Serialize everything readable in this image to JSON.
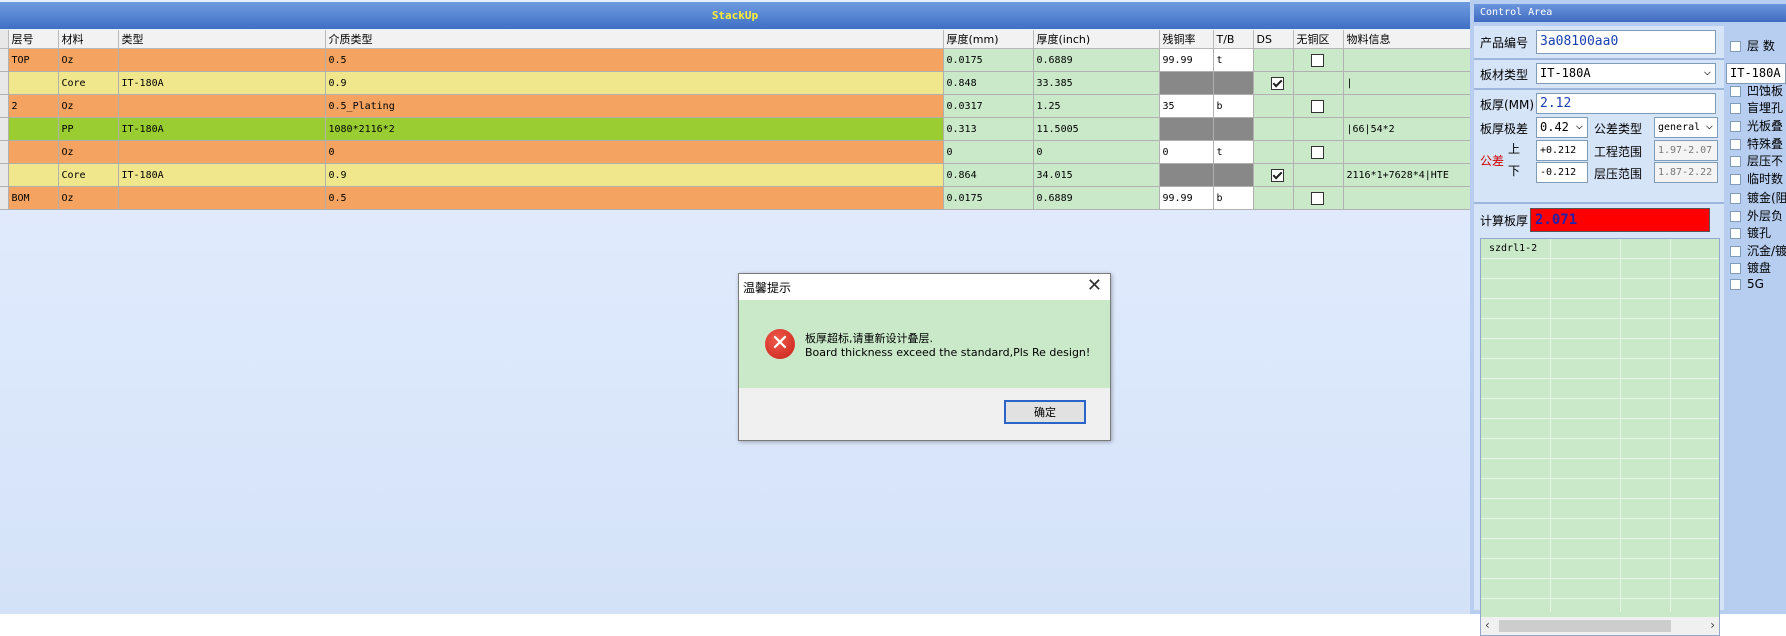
{
  "stackup": {
    "title": "StackUp",
    "columns": [
      "层号",
      "材料",
      "类型",
      "介质类型",
      "厚度(mm)",
      "厚度(inch)",
      "残铜率",
      "T/B",
      "DS",
      "无铜区",
      "物料信息"
    ],
    "rows": [
      {
        "layer": "TOP",
        "material": "Oz",
        "type": "",
        "dielectric": "0.5",
        "mm": "0.0175",
        "inch": "0.6889",
        "copper": "99.99",
        "tb": "t",
        "ds": "",
        "nocopper": "unchecked",
        "info": "",
        "color": "orange"
      },
      {
        "layer": "",
        "material": "Core",
        "type": "IT-180A",
        "dielectric": "0.9",
        "mm": "0.848",
        "inch": "33.385",
        "copper": "",
        "tb": "",
        "ds": "checked",
        "nocopper": "",
        "info": "|",
        "color": "yellow"
      },
      {
        "layer": "2",
        "material": "Oz",
        "type": "",
        "dielectric": "0.5_Plating",
        "mm": "0.0317",
        "inch": "1.25",
        "copper": "35",
        "tb": "b",
        "ds": "",
        "nocopper": "unchecked",
        "info": "",
        "color": "orange"
      },
      {
        "layer": "",
        "material": "PP",
        "type": "IT-180A",
        "dielectric": "1080*2116*2",
        "mm": "0.313",
        "inch": "11.5005",
        "copper": "",
        "tb": "",
        "ds": "",
        "nocopper": "",
        "info": "|66|54*2",
        "color": "green"
      },
      {
        "layer": "",
        "material": "Oz",
        "type": "",
        "dielectric": "0",
        "mm": "0",
        "inch": "0",
        "copper": "0",
        "tb": "t",
        "ds": "",
        "nocopper": "unchecked",
        "info": "",
        "color": "orange"
      },
      {
        "layer": "",
        "material": "Core",
        "type": "IT-180A",
        "dielectric": "0.9",
        "mm": "0.864",
        "inch": "34.015",
        "copper": "",
        "tb": "",
        "ds": "checked",
        "nocopper": "",
        "info": "2116*1+7628*4|HTE",
        "color": "yellow"
      },
      {
        "layer": "BOM",
        "material": "Oz",
        "type": "",
        "dielectric": "0.5",
        "mm": "0.0175",
        "inch": "0.6889",
        "copper": "99.99",
        "tb": "b",
        "ds": "",
        "nocopper": "unchecked",
        "info": "",
        "color": "orange"
      }
    ]
  },
  "dialog": {
    "title": "温馨提示",
    "message_cn": "板厚超标,请重新设计叠层.",
    "message_en": "Board thickness exceed the standard,Pls Re design!",
    "ok_label": "确定",
    "close_glyph": "✕",
    "icon_glyph": "✕"
  },
  "control": {
    "title": "Control Area",
    "product_no_label": "产品编号",
    "product_no": "3a08100aa0",
    "layers_label": "层  数",
    "board_type_label": "板材类型",
    "board_type": "IT-180A",
    "board_type_right": "IT-180A",
    "thickness_label": "板厚(MM)",
    "thickness": "2.12",
    "tolerance_label": "板厚极差",
    "tolerance": "0.42",
    "tol_type_label": "公差类型",
    "tol_type": "general",
    "tol_label": "公差",
    "upper_label": "上",
    "lower_label": "下",
    "upper_val": "+0.212",
    "lower_val": "-0.212",
    "eng_range_label": "工程范围",
    "eng_range": "1.97-2.07",
    "press_range_label": "层压范围",
    "press_range": "1.87-2.22",
    "calc_label": "计算板厚",
    "calc_val": "2.071",
    "drill_items": [
      "szdrl1-2"
    ],
    "scroll_left": "‹",
    "scroll_right": "›",
    "options": [
      "凹蚀板",
      "盲埋孔",
      "光板叠",
      "特殊叠",
      "层压不",
      "临时数",
      "镀金(阻",
      "外层负",
      "镀孔",
      "沉金/镀",
      "镀盘",
      "5G"
    ]
  },
  "colors": {
    "orange": "#f4a460",
    "yellow": "#f0e68c",
    "green": "#9acd32",
    "mint": "#c9e9c9",
    "calc_bg": "#ff0000"
  }
}
